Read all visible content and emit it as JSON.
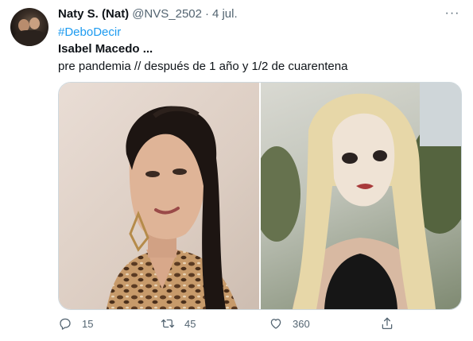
{
  "tweet": {
    "author_name": "Naty S. (Nat)",
    "handle": "@NVS_2502",
    "separator": "·",
    "date": "4 jul.",
    "more_label": "···",
    "hashtag": "#DeboDecir",
    "headline": "Isabel Macedo ...",
    "body": "pre pandemia // después de 1 año y 1/2 de cuarentena"
  },
  "actions": {
    "replies": "15",
    "retweets": "45",
    "likes": "360"
  },
  "colors": {
    "link": "#1d9bf0",
    "secondary_text": "#536471",
    "border": "#cfd9de"
  },
  "icons": [
    "more-icon",
    "reply-icon",
    "retweet-icon",
    "like-icon",
    "share-icon"
  ]
}
